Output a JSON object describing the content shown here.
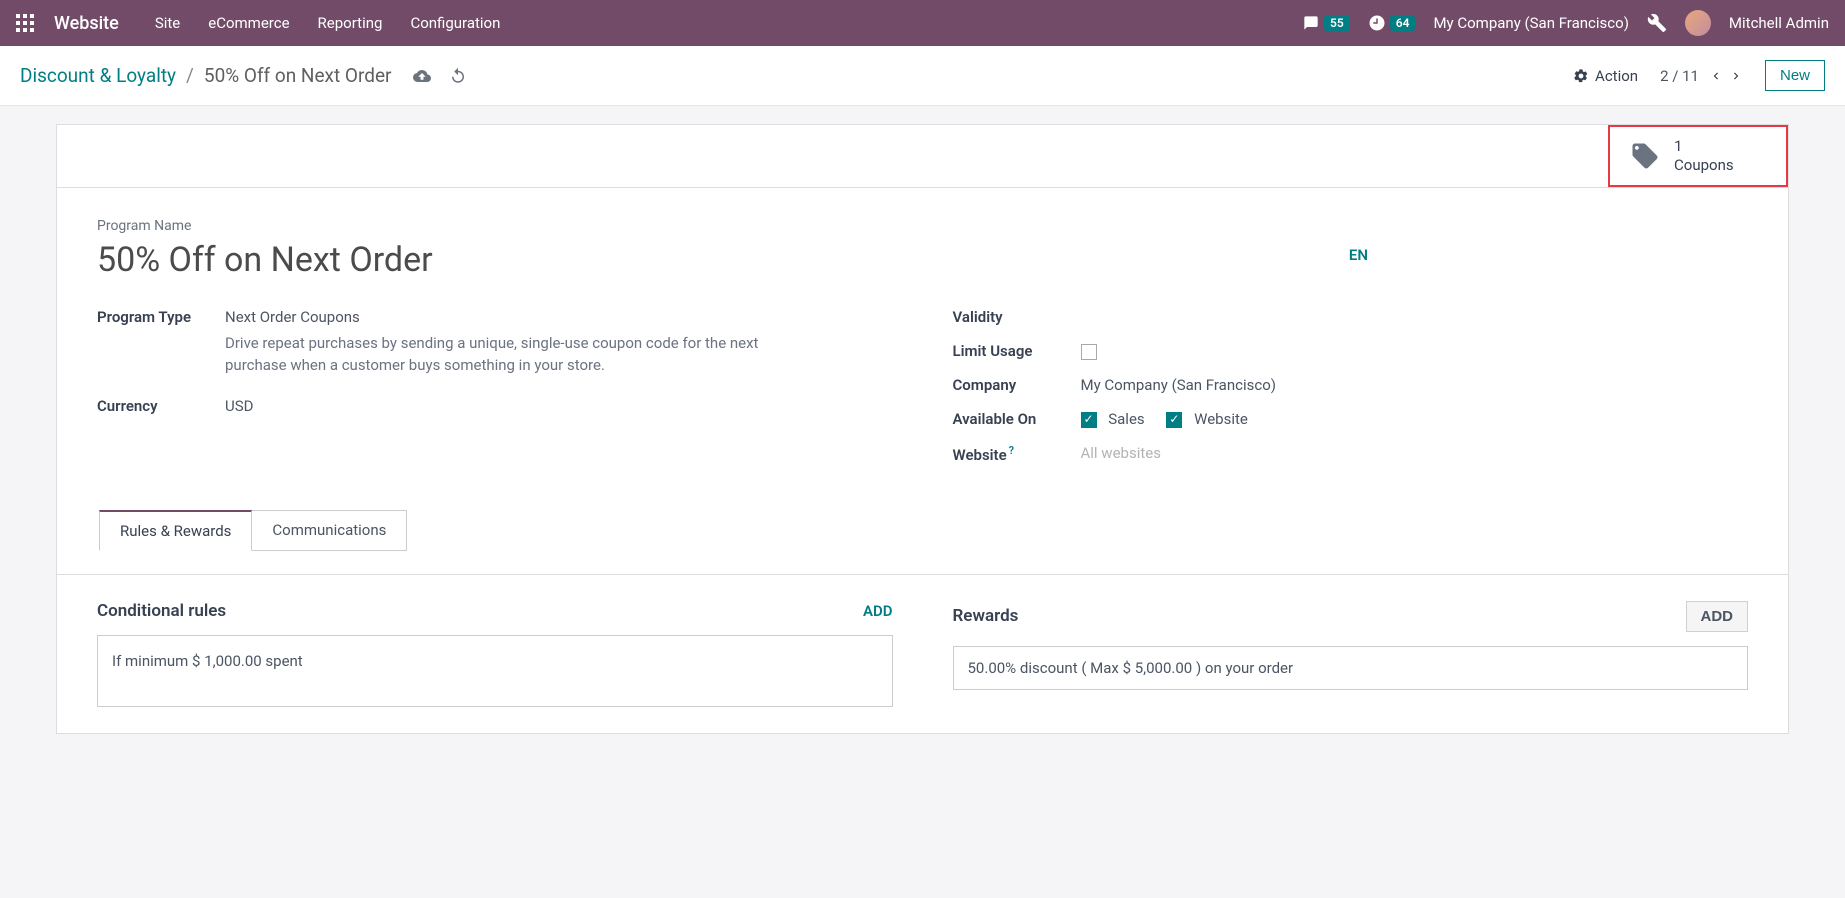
{
  "navbar": {
    "brand": "Website",
    "menu": [
      "Site",
      "eCommerce",
      "Reporting",
      "Configuration"
    ],
    "msg_badge": "55",
    "activity_badge": "64",
    "company": "My Company (San Francisco)",
    "user": "Mitchell Admin"
  },
  "controlbar": {
    "breadcrumb_root": "Discount & Loyalty",
    "breadcrumb_current": "50% Off on Next Order",
    "action_label": "Action",
    "pager_text": "2 / 11",
    "new_label": "New"
  },
  "stat": {
    "count": "1",
    "label": "Coupons"
  },
  "form": {
    "program_name_label": "Program Name",
    "program_name": "50% Off on Next Order",
    "lang": "EN",
    "program_type_label": "Program Type",
    "program_type_value": "Next Order Coupons",
    "program_type_desc": "Drive repeat purchases by sending a unique, single-use coupon code for the next purchase when a customer buys something in your store.",
    "currency_label": "Currency",
    "currency_value": "USD",
    "validity_label": "Validity",
    "limit_usage_label": "Limit Usage",
    "company_label": "Company",
    "company_value": "My Company (San Francisco)",
    "available_on_label": "Available On",
    "available_on_sales": "Sales",
    "available_on_website": "Website",
    "website_label": "Website",
    "website_placeholder": "All websites"
  },
  "tabs": {
    "rules": "Rules & Rewards",
    "comms": "Communications"
  },
  "sections": {
    "rules_title": "Conditional rules",
    "rules_add": "ADD",
    "rule_text": "If minimum $ 1,000.00 spent",
    "rewards_title": "Rewards",
    "rewards_add": "ADD",
    "reward_text": "50.00% discount ( Max $ 5,000.00 ) on your order"
  }
}
